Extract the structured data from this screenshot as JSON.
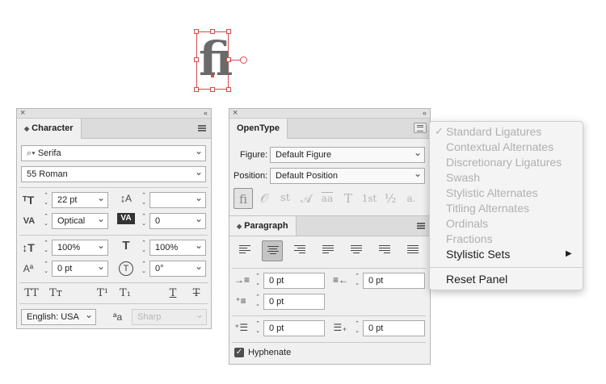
{
  "canvas": {
    "glyph": "fi"
  },
  "character_panel": {
    "title": "Character",
    "font_family": "Serifa",
    "font_style": "55 Roman",
    "font_size": "22 pt",
    "leading": "",
    "kerning": "Optical",
    "tracking": "0",
    "vertical_scale": "100%",
    "horizontal_scale": "100%",
    "baseline_shift": "0 pt",
    "skew": "0°",
    "style_buttons": [
      "TT",
      "Tт",
      "T¹",
      "T₁",
      "T",
      "T"
    ],
    "language": "English: USA",
    "aa_label": "ªa",
    "antialias": "Sharp"
  },
  "opentype_panel": {
    "title": "OpenType",
    "figure_label": "Figure:",
    "figure_value": "Default Figure",
    "position_label": "Position:",
    "position_value": "Default Position",
    "feature_glyphs": [
      "ﬁ",
      "𝒪",
      "st",
      "𝒜",
      "aa",
      "T",
      "1st",
      "½",
      "a."
    ]
  },
  "paragraph_panel": {
    "title": "Paragraph",
    "indent_left": "0 pt",
    "indent_right": "0 pt",
    "indent_first": "0 pt",
    "space_before": "0 pt",
    "space_after": "0 pt",
    "hyphenate_label": "Hyphenate",
    "hyphenate_checked": true
  },
  "flyout_menu": {
    "items": [
      {
        "label": "Standard Ligatures",
        "enabled": false,
        "checked": true
      },
      {
        "label": "Contextual Alternates",
        "enabled": false
      },
      {
        "label": "Discretionary Ligatures",
        "enabled": false
      },
      {
        "label": "Swash",
        "enabled": false
      },
      {
        "label": "Stylistic Alternates",
        "enabled": false
      },
      {
        "label": "Titling Alternates",
        "enabled": false
      },
      {
        "label": "Ordinals",
        "enabled": false
      },
      {
        "label": "Fractions",
        "enabled": false
      },
      {
        "label": "Stylistic Sets",
        "enabled": true,
        "submenu": true
      }
    ],
    "reset_label": "Reset Panel"
  },
  "colors": {
    "selection": "#d84a4a",
    "panel_bg": "#f0f0f0",
    "disabled_text": "#b0b0b0"
  }
}
